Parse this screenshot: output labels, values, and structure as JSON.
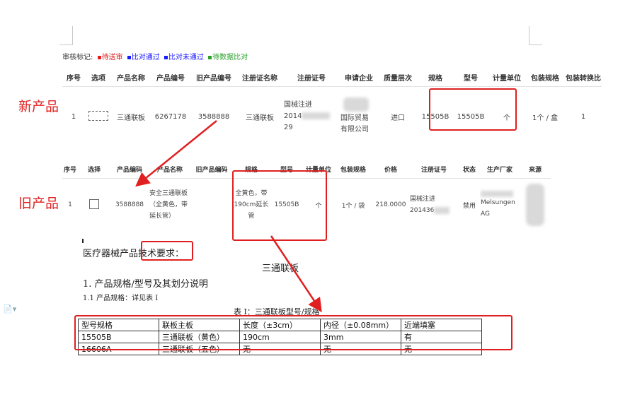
{
  "legend": {
    "prefix": "审核标记:",
    "items": [
      {
        "label": "待送审",
        "color": "#e02020"
      },
      {
        "label": "比对通过",
        "color": "#1a1aff"
      },
      {
        "label": "比对未通过",
        "color": "#1a1aff"
      },
      {
        "label": "待数据比对",
        "color": "#2aa02a"
      }
    ]
  },
  "labels": {
    "new_product": "新产品",
    "old_product": "旧产品"
  },
  "new_table": {
    "headers": [
      "序号",
      "选项",
      "产品名称",
      "产品编号",
      "旧产品编号",
      "注册证名称",
      "注册证号",
      "申请企业",
      "质量层次",
      "规格",
      "型号",
      "计量单位",
      "包装规格",
      "包装转换比"
    ],
    "row": {
      "index": "1",
      "name": "三通联板",
      "code": "6267178",
      "old_code": "3588888",
      "cert_name": "三通联板",
      "cert_no_line1": "国械注进",
      "cert_no_line2_a": "2014",
      "cert_no_line2_b": "29",
      "company": "国际贸易有限公司",
      "quality": "进口",
      "spec": "15505B",
      "model": "15505B",
      "unit": "个",
      "pack": "1个 / 盒",
      "ratio": "1"
    }
  },
  "old_table": {
    "headers": [
      "序号",
      "选择",
      "产品编码",
      "产品名称",
      "旧产品编码",
      "规格",
      "型号",
      "计量单位",
      "包装规格",
      "价格",
      "注册证号",
      "状态",
      "生产厂家",
      "来源"
    ],
    "row": {
      "index": "1",
      "code": "3588888",
      "name": "安全三通联板（全黄色，带延长管）",
      "old_code": "",
      "spec": "全黄色，带190cm延长管",
      "model": "15505B",
      "unit": "个",
      "pack": "1个 / 袋",
      "price": "218.0000",
      "cert_line1": "国械注进",
      "cert_line2": "201436",
      "status": "禁用",
      "maker_line1": "Melsungen",
      "maker_line2": "AG"
    }
  },
  "document": {
    "heading_prefix": "医疗器械产品",
    "heading_boxed": "技术要求：",
    "title": "三通联板",
    "section1": "1.  产品规格/型号及其划分说明",
    "section1_1": "1.1 产品规格：详见表 I",
    "table_caption": "表 I：三通联板型号/规格",
    "spec_table": {
      "headers": [
        "型号规格",
        "联板主板",
        "长度（±3cm）",
        "内径（±0.08mm）",
        "近端填塞"
      ],
      "rows": [
        [
          "15505B",
          "三通联板（黄色）",
          "190cm",
          "3mm",
          "有"
        ],
        [
          "16606A",
          "三通联板（五色）",
          "无",
          "无",
          "无"
        ]
      ]
    }
  },
  "colors": {
    "annotation_red": "#e02020"
  }
}
